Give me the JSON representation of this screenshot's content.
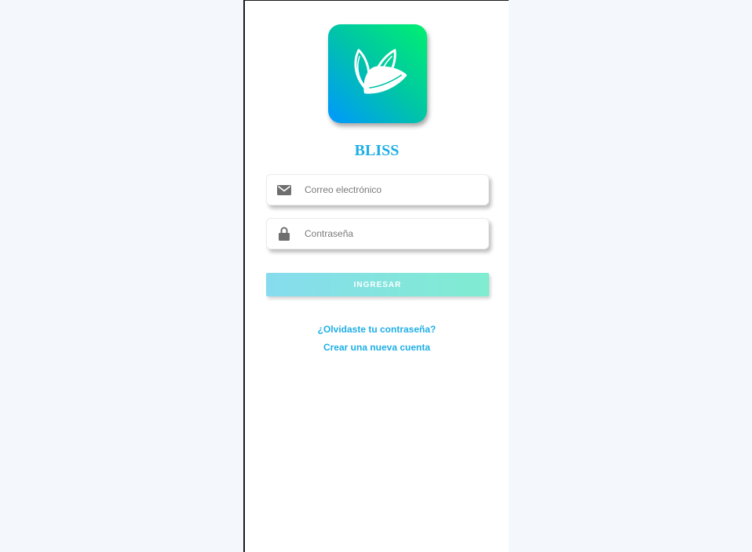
{
  "app": {
    "brand_name": "BLISS",
    "logo_icon": "leaf-logo-icon"
  },
  "login": {
    "email": {
      "icon": "envelope-icon",
      "placeholder": "Correo electrónico",
      "value": ""
    },
    "password": {
      "icon": "lock-icon",
      "placeholder": "Contraseña",
      "value": ""
    },
    "submit_label": "INGRESAR",
    "forgot_password_label": "¿Olvidaste tu contraseña?",
    "create_account_label": "Crear una nueva cuenta"
  },
  "colors": {
    "accent": "#1eaee6",
    "logo_gradient_start": "#0098ff",
    "logo_gradient_end": "#00f070",
    "button_gradient_start": "#86dcee",
    "button_gradient_end": "#80ecd0",
    "background": "#f4f8fc"
  }
}
